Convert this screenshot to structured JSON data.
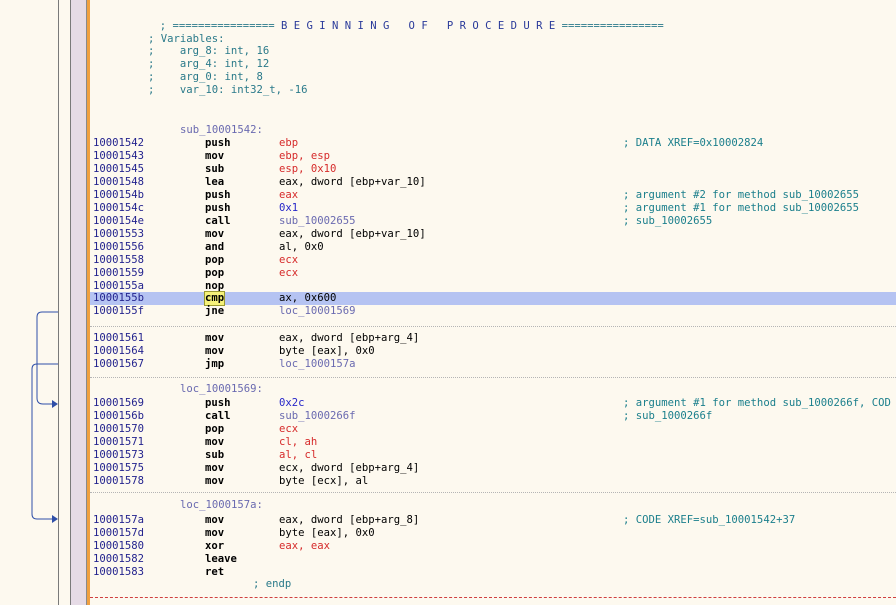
{
  "banner": {
    "prefix": ";",
    "left_rule": "================",
    "text": "B E G I N N I N G   O F   P R O C E D U R E",
    "right_rule": "================"
  },
  "variables_header": "; Variables:",
  "variables": [
    "arg_8: int, 16",
    "arg_4: int, 12",
    "arg_0: int, 8",
    "var_10: int32_t, -16"
  ],
  "proc_label": "sub_10001542:",
  "labels": {
    "loc1": "loc_10001569:",
    "loc2": "loc_1000157a:"
  },
  "endp": "; endp",
  "rows": [
    {
      "addr": "10001542",
      "mnem": "push",
      "ops": "ebp",
      "cmt": "; DATA XREF=0x10002824"
    },
    {
      "addr": "10001543",
      "mnem": "mov",
      "ops": "ebp, esp",
      "cmt": ""
    },
    {
      "addr": "10001545",
      "mnem": "sub",
      "ops": "esp, 0x10",
      "cmt": ""
    },
    {
      "addr": "10001548",
      "mnem": "lea",
      "ops": "eax, dword [ebp+var_10]",
      "cmt": ""
    },
    {
      "addr": "1000154b",
      "mnem": "push",
      "ops": "eax",
      "cmt": "; argument #2 for method sub_10002655"
    },
    {
      "addr": "1000154c",
      "mnem": "push",
      "ops": "0x1",
      "cmt": "; argument #1 for method sub_10002655"
    },
    {
      "addr": "1000154e",
      "mnem": "call",
      "ops": "sub_10002655",
      "cmt": "; sub_10002655"
    },
    {
      "addr": "10001553",
      "mnem": "mov",
      "ops": "eax, dword [ebp+var_10]",
      "cmt": ""
    },
    {
      "addr": "10001556",
      "mnem": "and",
      "ops": "al, 0x0",
      "cmt": ""
    },
    {
      "addr": "10001558",
      "mnem": "pop",
      "ops": "ecx",
      "cmt": ""
    },
    {
      "addr": "10001559",
      "mnem": "pop",
      "ops": "ecx",
      "cmt": ""
    },
    {
      "addr": "1000155a",
      "mnem": "nop",
      "ops": "",
      "cmt": ""
    },
    {
      "addr": "1000155b",
      "mnem": "cmp",
      "ops": "ax, 0x600",
      "cmt": ""
    },
    {
      "addr": "1000155f",
      "mnem": "jne",
      "ops": "loc_10001569",
      "cmt": ""
    },
    {
      "addr": "10001561",
      "mnem": "mov",
      "ops": "eax, dword [ebp+arg_4]",
      "cmt": ""
    },
    {
      "addr": "10001564",
      "mnem": "mov",
      "ops": "byte [eax], 0x0",
      "cmt": ""
    },
    {
      "addr": "10001567",
      "mnem": "jmp",
      "ops": "loc_1000157a",
      "cmt": ""
    },
    {
      "addr": "10001569",
      "mnem": "push",
      "ops": "0x2c",
      "cmt": "; argument #1 for method sub_1000266f, COD"
    },
    {
      "addr": "1000156b",
      "mnem": "call",
      "ops": "sub_1000266f",
      "cmt": "; sub_1000266f"
    },
    {
      "addr": "10001570",
      "mnem": "pop",
      "ops": "ecx",
      "cmt": ""
    },
    {
      "addr": "10001571",
      "mnem": "mov",
      "ops": "cl, ah",
      "cmt": ""
    },
    {
      "addr": "10001573",
      "mnem": "sub",
      "ops": "al, cl",
      "cmt": ""
    },
    {
      "addr": "10001575",
      "mnem": "mov",
      "ops": "ecx, dword [ebp+arg_4]",
      "cmt": ""
    },
    {
      "addr": "10001578",
      "mnem": "mov",
      "ops": "byte [ecx], al",
      "cmt": ""
    },
    {
      "addr": "1000157a",
      "mnem": "mov",
      "ops": "eax, dword [ebp+arg_8]",
      "cmt": "; CODE XREF=sub_10001542+37"
    },
    {
      "addr": "1000157d",
      "mnem": "mov",
      "ops": "byte [eax], 0x0",
      "cmt": ""
    },
    {
      "addr": "10001580",
      "mnem": "xor",
      "ops": "eax, eax",
      "cmt": ""
    },
    {
      "addr": "10001582",
      "mnem": "leave",
      "ops": "",
      "cmt": ""
    },
    {
      "addr": "10001583",
      "mnem": "ret",
      "ops": "",
      "cmt": ""
    }
  ],
  "colors": {
    "background": "#fdf9ef",
    "address": "#23238e",
    "register": "#d62b2b",
    "number": "#2727c9",
    "label_ref": "#6a6ab0",
    "variable": "#20a3a3",
    "comment": "#1b7f8c",
    "selection": "#b5c3f2",
    "cursor": "#f6f27a",
    "gutter": "#e6dbe6",
    "arrow": "#2f4fa8"
  }
}
